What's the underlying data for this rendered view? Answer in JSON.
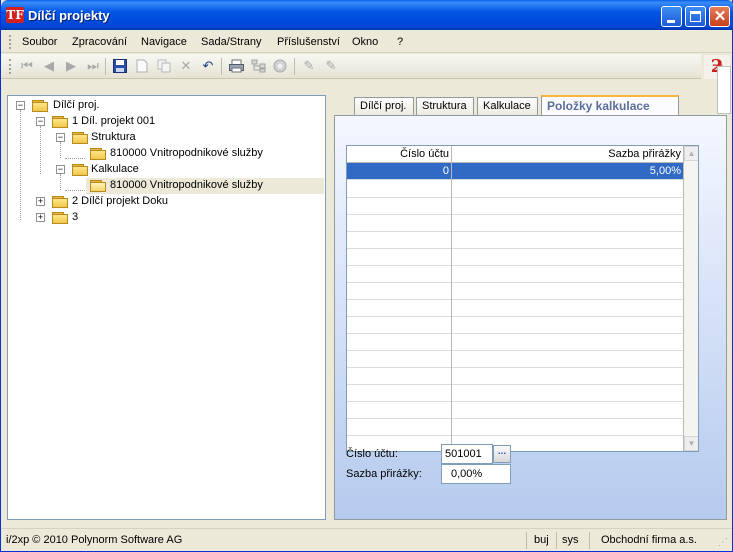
{
  "window": {
    "title": "Dílčí projekty",
    "logo": "TF"
  },
  "menu": [
    "Soubor",
    "Zpracování",
    "Navigace",
    "Sada/Strany",
    "Příslušenství",
    "Okno",
    "?"
  ],
  "toolbar": {
    "icons": [
      "first-icon",
      "prev-icon",
      "next-icon",
      "last-icon",
      "save-icon",
      "new-icon",
      "copy-icon",
      "delete-icon",
      "undo-icon",
      "print-icon",
      "structure-icon",
      "search-icon",
      "edit-icon",
      "edit-alt-icon"
    ]
  },
  "tree": {
    "root": "Dílčí proj.",
    "project1": "1 Díl. projekt 001",
    "struktura": "Struktura",
    "struktura_item": "810000 Vnitropodnikové služby",
    "kalkulace": "Kalkulace",
    "kalkulace_item": "810000 Vnitropodnikové služby",
    "project2": "2 Dílčí projekt Doku",
    "project3": "3"
  },
  "tabs": {
    "items": [
      "Dílčí proj.",
      "Struktura",
      "Kalkulace",
      "Položky kalkulace"
    ],
    "active_index": 3
  },
  "grid": {
    "columns": [
      "Číslo účtu",
      "Sazba přirážky"
    ],
    "rows": [
      [
        "0",
        "5,00%"
      ]
    ]
  },
  "form": {
    "account_label": "Číslo účtu:",
    "account_value": "501001",
    "lookup_label": "...",
    "rate_label": "Sazba přirážky:",
    "rate_value": "0,00%"
  },
  "status": {
    "copyright": "i/2xp © 2010 Polynorm Software AG",
    "user": "buj",
    "system": "sys",
    "company": "Obchodní firma a.s."
  }
}
